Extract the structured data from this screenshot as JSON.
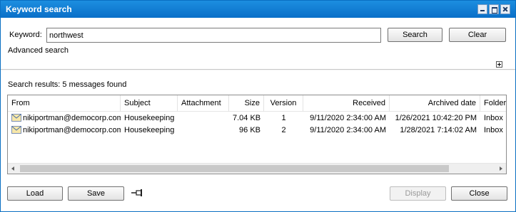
{
  "window": {
    "title": "Keyword search"
  },
  "search": {
    "keyword_label": "Keyword:",
    "keyword_value": "northwest",
    "search_button": "Search",
    "clear_button": "Clear",
    "advanced_link": "Advanced search"
  },
  "results": {
    "count_text": "Search results: 5 messages found",
    "columns": [
      "From",
      "Subject",
      "Attachment",
      "Size",
      "Version",
      "Received",
      "Archived date",
      "Folder"
    ],
    "rows": [
      {
        "from": "nikiportman@democorp.com",
        "subject": "Housekeeping",
        "attachment": "",
        "size": "7.04 KB",
        "version": "1",
        "received": "9/11/2020 2:34:00 AM",
        "archived": "1/26/2021 10:42:20 PM",
        "folder": "Inbox"
      },
      {
        "from": "nikiportman@democorp.com",
        "subject": "Housekeeping",
        "attachment": "",
        "size": "96 KB",
        "version": "2",
        "received": "9/11/2020 2:34:00 AM",
        "archived": "1/28/2021 7:14:02 AM",
        "folder": "Inbox"
      }
    ]
  },
  "footer": {
    "load_button": "Load",
    "save_button": "Save",
    "display_button": "Display",
    "close_button": "Close"
  },
  "icons": {
    "row_icon": "mail-icon",
    "pin": "pin-icon",
    "expand": "expand-icon"
  },
  "colors": {
    "titlebar": "#0a6fc8",
    "disabled_text": "#9a9a9a"
  }
}
